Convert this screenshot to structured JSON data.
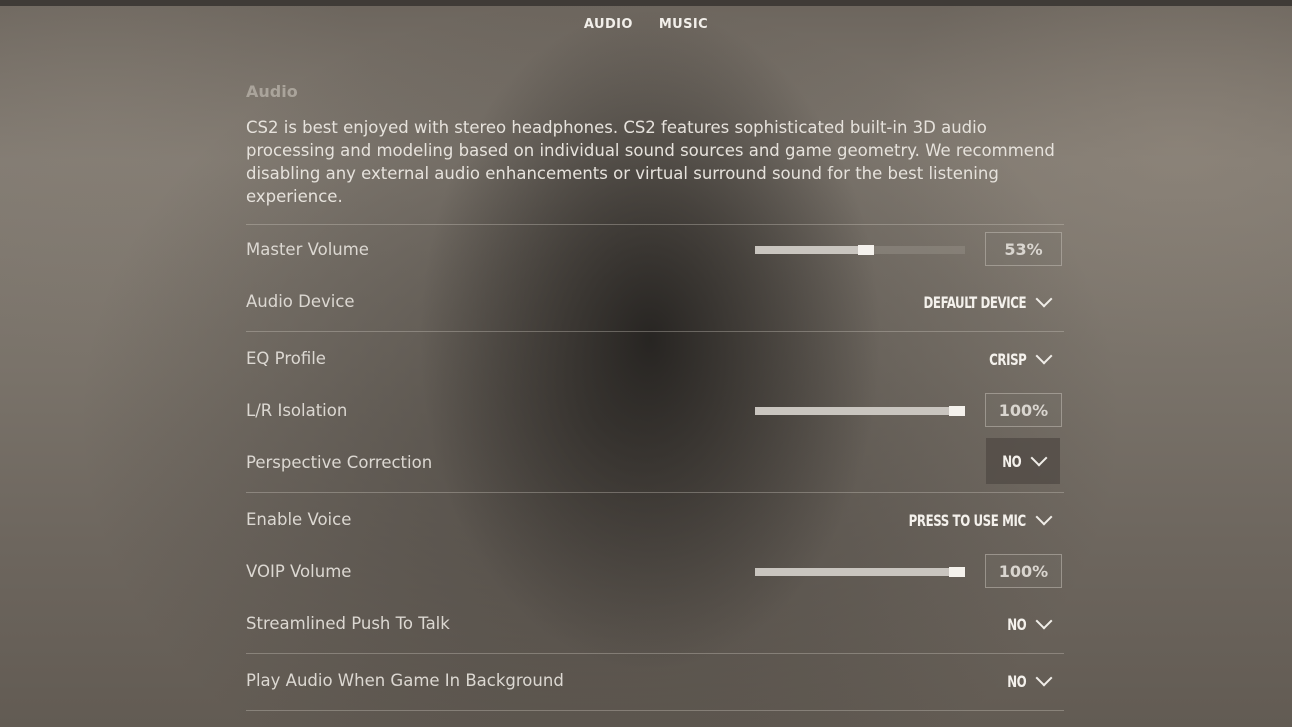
{
  "tabs": [
    {
      "label": "AUDIO"
    },
    {
      "label": "MUSIC"
    }
  ],
  "section": {
    "title": "Audio",
    "description": "CS2 is best enjoyed with stereo headphones. CS2 features sophisticated built-in 3D audio processing and modeling based on individual sound sources and game geometry. We recommend disabling any external audio enhancements or virtual surround sound for the best listening experience."
  },
  "settings": {
    "master_volume": {
      "label": "Master Volume",
      "value_text": "53%",
      "level": 0.53
    },
    "audio_device": {
      "label": "Audio Device",
      "value": "DEFAULT DEVICE"
    },
    "eq_profile": {
      "label": "EQ Profile",
      "value": "CRISP"
    },
    "lr_isolation": {
      "label": "L/R Isolation",
      "value_text": "100%",
      "level": 1.0
    },
    "perspective_correction": {
      "label": "Perspective Correction",
      "value": "NO"
    },
    "enable_voice": {
      "label": "Enable Voice",
      "value": "PRESS TO USE MIC"
    },
    "voip_volume": {
      "label": "VOIP Volume",
      "value_text": "100%",
      "level": 1.0
    },
    "streamlined_ptt": {
      "label": "Streamlined Push To Talk",
      "value": "NO"
    },
    "play_audio_background": {
      "label": "Play Audio When Game In Background",
      "value": "NO"
    }
  },
  "icons": {
    "dropdown": "chevron-down-icon"
  }
}
